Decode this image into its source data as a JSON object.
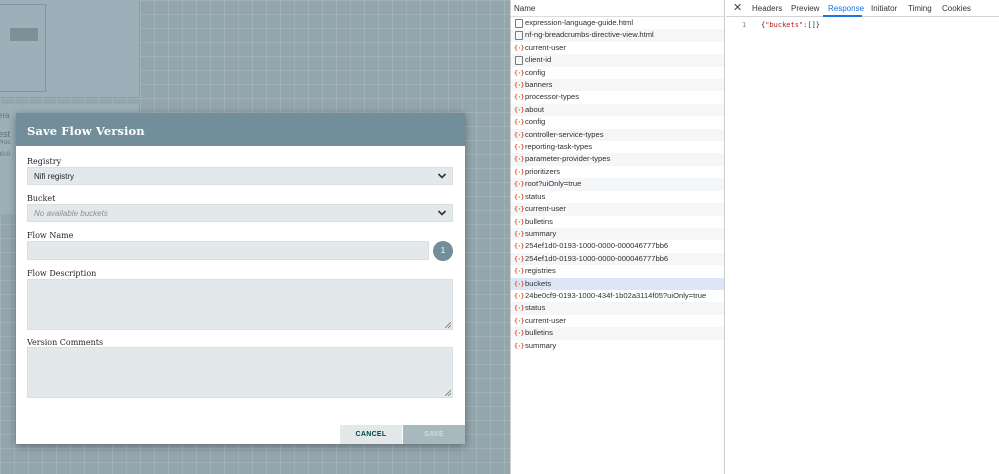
{
  "modal": {
    "title": "Save Flow Version",
    "registry_label": "Registry",
    "registry_value": "Nifi registry",
    "bucket_label": "Bucket",
    "bucket_value": "No available buckets",
    "flow_name_label": "Flow Name",
    "flow_name_value": "",
    "flow_name_badge": "1",
    "flow_description_label": "Flow Description",
    "version_comments_label": "Version Comments",
    "cancel_label": "CANCEL",
    "save_label": "SAVE"
  },
  "network": {
    "column_header": "Name",
    "rows": [
      {
        "name": "expression-language-guide.html",
        "type": "doc"
      },
      {
        "name": "nf-ng-breadcrumbs-directive-view.html",
        "type": "doc"
      },
      {
        "name": "current-user",
        "type": "xhr"
      },
      {
        "name": "client-id",
        "type": "doc"
      },
      {
        "name": "config",
        "type": "xhr"
      },
      {
        "name": "banners",
        "type": "xhr"
      },
      {
        "name": "processor-types",
        "type": "xhr"
      },
      {
        "name": "about",
        "type": "xhr"
      },
      {
        "name": "config",
        "type": "xhr"
      },
      {
        "name": "controller-service-types",
        "type": "xhr"
      },
      {
        "name": "reporting-task-types",
        "type": "xhr"
      },
      {
        "name": "parameter-provider-types",
        "type": "xhr"
      },
      {
        "name": "prioritizers",
        "type": "xhr"
      },
      {
        "name": "root?uiOnly=true",
        "type": "xhr"
      },
      {
        "name": "status",
        "type": "xhr"
      },
      {
        "name": "current-user",
        "type": "xhr"
      },
      {
        "name": "bulletins",
        "type": "xhr"
      },
      {
        "name": "summary",
        "type": "xhr"
      },
      {
        "name": "254ef1d0-0193-1000-0000-000046777bb6",
        "type": "xhr"
      },
      {
        "name": "254ef1d0-0193-1000-0000-000046777bb6",
        "type": "xhr"
      },
      {
        "name": "registries",
        "type": "xhr"
      },
      {
        "name": "buckets",
        "type": "xhr",
        "selected": true
      },
      {
        "name": "24be0cf9-0193-1000-434f-1b02a3114f05?uiOnly=true",
        "type": "xhr"
      },
      {
        "name": "status",
        "type": "xhr"
      },
      {
        "name": "current-user",
        "type": "xhr"
      },
      {
        "name": "bulletins",
        "type": "xhr"
      },
      {
        "name": "summary",
        "type": "xhr"
      }
    ]
  },
  "devtools": {
    "close_glyph": "✕",
    "tabs": [
      "Headers",
      "Preview",
      "Response",
      "Initiator",
      "Timing",
      "Cookies"
    ],
    "active_tab": "Response",
    "response_line_number": "1",
    "response_key": "\"buckets\"",
    "response_rest": ":[]}",
    "response_open": "{"
  },
  "colors": {
    "modal_header": "#728e9b",
    "canvas_bg": "#93a5ad",
    "selected_row": "#dde6f7",
    "active_tab": "#1a73e8"
  }
}
